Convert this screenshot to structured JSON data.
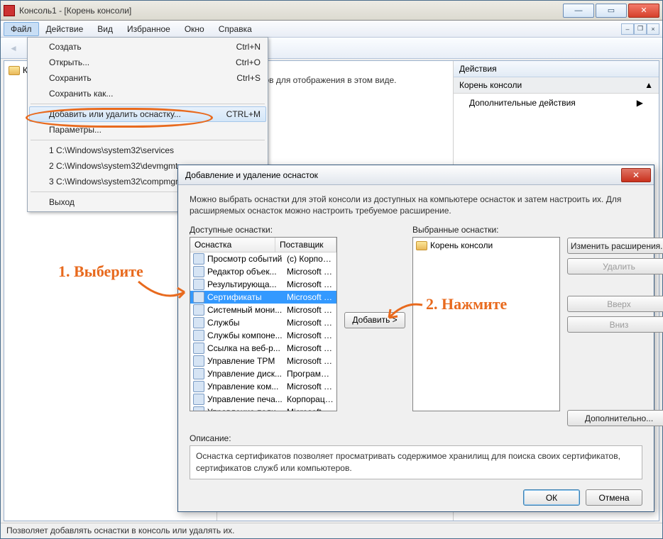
{
  "main_window": {
    "title": "Консоль1 - [Корень консоли]",
    "status_text": "Позволяет добавлять оснастки в консоль или удалять их."
  },
  "menubar": {
    "items": [
      "Файл",
      "Действие",
      "Вид",
      "Избранное",
      "Окно",
      "Справка"
    ]
  },
  "file_menu": {
    "create": {
      "label": "Создать",
      "shortcut": "Ctrl+N"
    },
    "open": {
      "label": "Открыть...",
      "shortcut": "Ctrl+O"
    },
    "save": {
      "label": "Сохранить",
      "shortcut": "Ctrl+S"
    },
    "saveas": {
      "label": "Сохранить как..."
    },
    "addremove": {
      "label": "Добавить или удалить оснастку...",
      "shortcut": "CTRL+M"
    },
    "options": {
      "label": "Параметры..."
    },
    "recent": [
      "1 C:\\Windows\\system32\\services",
      "2 C:\\Windows\\system32\\devmgmt",
      "3 C:\\Windows\\system32\\compmgm"
    ],
    "exit": {
      "label": "Выход"
    }
  },
  "tree": {
    "root": "Корень консоли"
  },
  "center": {
    "empty_text": "элементов для отображения в этом виде."
  },
  "actions": {
    "header": "Действия",
    "section": "Корень консоли",
    "more": "Дополнительные действия"
  },
  "dialog": {
    "title": "Добавление и удаление оснасток",
    "intro": "Можно выбрать оснастки для этой консоли из доступных на компьютере оснасток и затем настроить их. Для расширяемых оснасток можно настроить требуемое расширение.",
    "available_label": "Доступные оснастки:",
    "selected_label": "Выбранные оснастки:",
    "col_snapin": "Оснастка",
    "col_vendor": "Поставщик",
    "snapins": [
      {
        "name": "Просмотр событий",
        "vendor": "(c) Корпора..."
      },
      {
        "name": "Редактор объек...",
        "vendor": "Microsoft C..."
      },
      {
        "name": "Результирующа...",
        "vendor": "Microsoft C..."
      },
      {
        "name": "Сертификаты",
        "vendor": "Microsoft C..."
      },
      {
        "name": "Системный мони...",
        "vendor": "Microsoft C..."
      },
      {
        "name": "Службы",
        "vendor": "Microsoft C..."
      },
      {
        "name": "Службы компоне...",
        "vendor": "Microsoft C..."
      },
      {
        "name": "Ссылка на веб-р...",
        "vendor": "Microsoft C..."
      },
      {
        "name": "Управление TPM",
        "vendor": "Microsoft C..."
      },
      {
        "name": "Управление диск...",
        "vendor": "Программн..."
      },
      {
        "name": "Управление ком...",
        "vendor": "Microsoft C..."
      },
      {
        "name": "Управление печа...",
        "vendor": "Корпораци..."
      },
      {
        "name": "Управление поли...",
        "vendor": "Microsoft C..."
      }
    ],
    "selected_root": "Корень консоли",
    "add_btn": "Добавить >",
    "edit_ext_btn": "Изменить расширения...",
    "remove_btn": "Удалить",
    "up_btn": "Вверх",
    "down_btn": "Вниз",
    "advanced_btn": "Дополнительно...",
    "desc_label": "Описание:",
    "desc_text": "Оснастка сертификатов позволяет просматривать содержимое хранилищ для поиска своих сертификатов, сертификатов служб или компьютеров.",
    "ok": "ОК",
    "cancel": "Отмена"
  },
  "annotations": {
    "step1": "1. Выберите",
    "step2": "2. Нажмите"
  }
}
